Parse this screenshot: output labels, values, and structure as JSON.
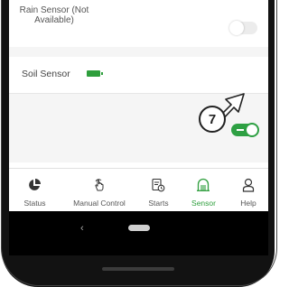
{
  "sensors": {
    "rain": {
      "label": "Rain Sensor (Not Available)",
      "enabled": false
    },
    "soil": {
      "label": "Soil Sensor",
      "enabled": true,
      "battery_icon": "battery-full-icon"
    }
  },
  "callout": {
    "number": "7"
  },
  "tabs": [
    {
      "label": "Status",
      "icon": "pie-chart-icon"
    },
    {
      "label": "Manual Control",
      "icon": "hand-pointer-icon"
    },
    {
      "label": "Starts",
      "icon": "schedule-icon"
    },
    {
      "label": "Sensor",
      "icon": "sensor-icon",
      "active": true
    },
    {
      "label": "Help",
      "icon": "help-icon"
    }
  ],
  "navbar": {
    "back_icon": "‹"
  },
  "colors": {
    "accent": "#2e9e3c",
    "toggle_on": "#2ea043"
  }
}
